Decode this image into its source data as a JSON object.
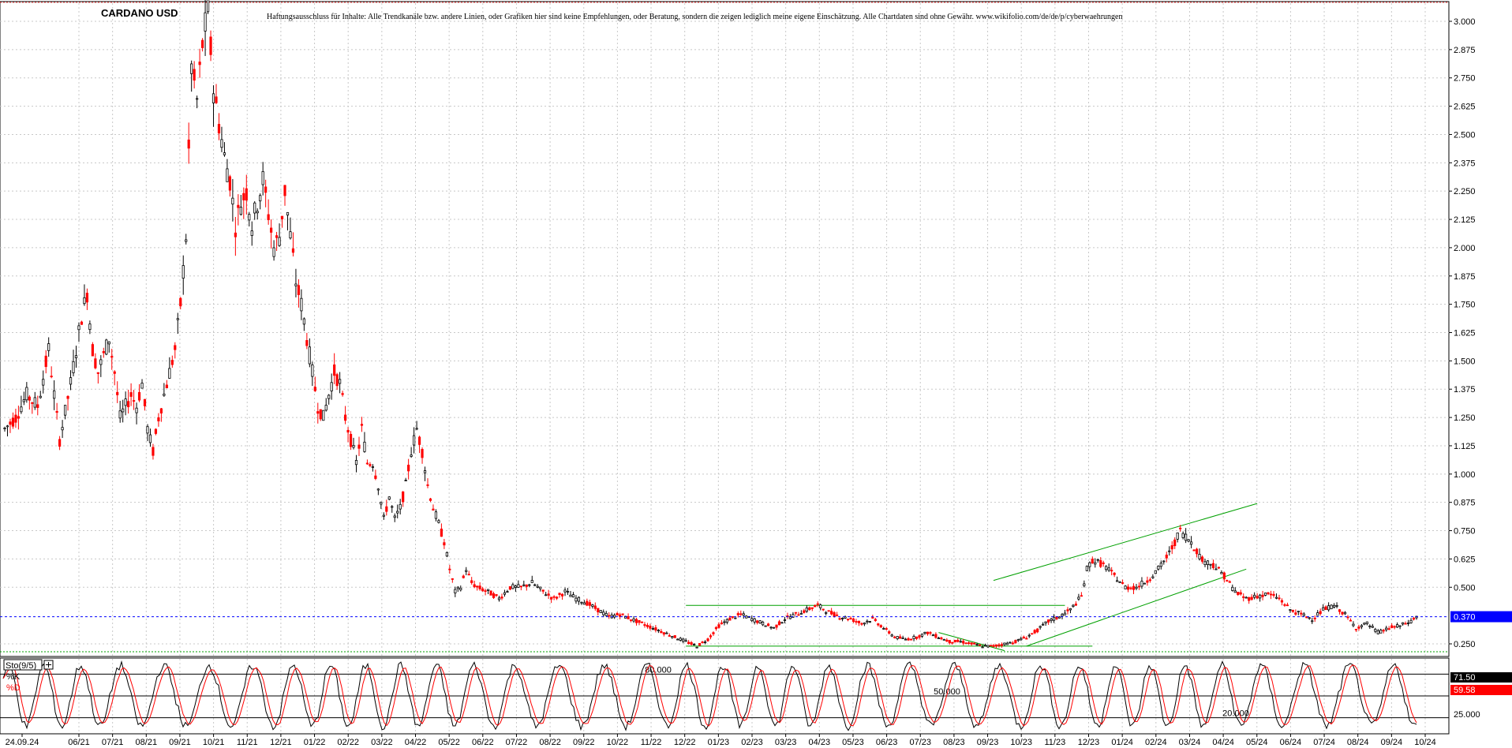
{
  "chart_data": [
    {
      "type": "candlestick",
      "title": "CARDANO USD",
      "disclaimer": "Haftungsausschluss für Inhalte: Alle Trendkanäle bzw. andere Linien, oder Grafiken hier sind keine Empfehlungen, oder Beratung, sondern die zeigen lediglich meine eigene Einschätzung. Alle Chartdaten sind ohne Gewähr. www.wikifolio.com/de/de/p/cyberwaehrungen",
      "ylim": [
        0.2,
        3.15
      ],
      "yticks": [
        "3.000",
        "2.875",
        "2.750",
        "2.625",
        "2.500",
        "2.375",
        "2.250",
        "2.125",
        "2.000",
        "1.875",
        "1.750",
        "1.625",
        "1.500",
        "1.375",
        "1.250",
        "1.125",
        "1.000",
        "0.875",
        "0.750",
        "0.625",
        "0.500",
        "0.370",
        "0.250"
      ],
      "xticks": [
        "24.09.24",
        "06/21",
        "07/21",
        "08/21",
        "09/21",
        "10/21",
        "11/21",
        "12/21",
        "01/22",
        "02/22",
        "03/22",
        "04/22",
        "05/22",
        "06/22",
        "07/22",
        "08/22",
        "09/22",
        "10/22",
        "11/22",
        "12/22",
        "01/23",
        "02/23",
        "03/23",
        "04/23",
        "05/23",
        "06/23",
        "07/23",
        "08/23",
        "09/23",
        "10/23",
        "11/23",
        "12/23",
        "01/24",
        "02/24",
        "03/24",
        "04/24",
        "05/24",
        "06/24",
        "07/24",
        "08/24",
        "09/24",
        "10/24"
      ],
      "up_color": "#000000",
      "down_color": "#ff0000",
      "price_path": [
        [
          0,
          1.2
        ],
        [
          2,
          1.25
        ],
        [
          4,
          1.35
        ],
        [
          6,
          1.3
        ],
        [
          8,
          1.55
        ],
        [
          9,
          1.35
        ],
        [
          10,
          1.15
        ],
        [
          12,
          1.4
        ],
        [
          14,
          1.7
        ],
        [
          15,
          1.8
        ],
        [
          16,
          1.55
        ],
        [
          17,
          1.45
        ],
        [
          19,
          1.6
        ],
        [
          20,
          1.45
        ],
        [
          21,
          1.25
        ],
        [
          23,
          1.35
        ],
        [
          24,
          1.3
        ],
        [
          25,
          1.4
        ],
        [
          26,
          1.2
        ],
        [
          27,
          1.1
        ],
        [
          28,
          1.25
        ],
        [
          29,
          1.35
        ],
        [
          30,
          1.45
        ],
        [
          31,
          1.55
        ],
        [
          32,
          1.75
        ],
        [
          33,
          2.05
        ],
        [
          34,
          2.8
        ],
        [
          35,
          2.65
        ],
        [
          36,
          2.9
        ],
        [
          37,
          3.05
        ],
        [
          38,
          2.7
        ],
        [
          39,
          2.55
        ],
        [
          40,
          2.4
        ],
        [
          41,
          2.3
        ],
        [
          42,
          2.1
        ],
        [
          43,
          2.2
        ],
        [
          44,
          2.25
        ],
        [
          45,
          2.1
        ],
        [
          46,
          2.2
        ],
        [
          47,
          2.3
        ],
        [
          48,
          2.15
        ],
        [
          49,
          2.0
        ],
        [
          50,
          2.05
        ],
        [
          51,
          2.25
        ],
        [
          52,
          2.05
        ],
        [
          53,
          1.85
        ],
        [
          54,
          1.75
        ],
        [
          55,
          1.6
        ],
        [
          56,
          1.45
        ],
        [
          57,
          1.3
        ],
        [
          58,
          1.25
        ],
        [
          59,
          1.35
        ],
        [
          60,
          1.45
        ],
        [
          61,
          1.4
        ],
        [
          62,
          1.25
        ],
        [
          63,
          1.15
        ],
        [
          64,
          1.05
        ],
        [
          65,
          1.2
        ],
        [
          66,
          1.05
        ],
        [
          67,
          1.05
        ],
        [
          68,
          0.95
        ],
        [
          69,
          0.8
        ],
        [
          70,
          0.9
        ],
        [
          71,
          0.8
        ],
        [
          72,
          0.85
        ],
        [
          73,
          0.95
        ],
        [
          74,
          1.1
        ],
        [
          75,
          1.2
        ],
        [
          76,
          1.1
        ],
        [
          77,
          0.95
        ],
        [
          78,
          0.85
        ],
        [
          79,
          0.78
        ],
        [
          80,
          0.7
        ],
        [
          81,
          0.58
        ],
        [
          82,
          0.48
        ],
        [
          83,
          0.5
        ],
        [
          84,
          0.58
        ],
        [
          85,
          0.52
        ],
        [
          86,
          0.5
        ],
        [
          88,
          0.48
        ],
        [
          90,
          0.45
        ],
        [
          92,
          0.5
        ],
        [
          94,
          0.5
        ],
        [
          96,
          0.52
        ],
        [
          98,
          0.48
        ],
        [
          100,
          0.45
        ],
        [
          102,
          0.48
        ],
        [
          104,
          0.45
        ],
        [
          106,
          0.43
        ],
        [
          108,
          0.4
        ],
        [
          110,
          0.37
        ],
        [
          112,
          0.38
        ],
        [
          114,
          0.36
        ],
        [
          116,
          0.34
        ],
        [
          118,
          0.32
        ],
        [
          120,
          0.3
        ],
        [
          122,
          0.28
        ],
        [
          124,
          0.26
        ],
        [
          126,
          0.24
        ],
        [
          128,
          0.27
        ],
        [
          130,
          0.33
        ],
        [
          132,
          0.36
        ],
        [
          134,
          0.38
        ],
        [
          136,
          0.36
        ],
        [
          138,
          0.34
        ],
        [
          140,
          0.32
        ],
        [
          142,
          0.36
        ],
        [
          144,
          0.38
        ],
        [
          146,
          0.4
        ],
        [
          148,
          0.42
        ],
        [
          150,
          0.39
        ],
        [
          152,
          0.37
        ],
        [
          154,
          0.36
        ],
        [
          156,
          0.34
        ],
        [
          158,
          0.36
        ],
        [
          160,
          0.32
        ],
        [
          162,
          0.28
        ],
        [
          164,
          0.27
        ],
        [
          166,
          0.28
        ],
        [
          168,
          0.3
        ],
        [
          170,
          0.28
        ],
        [
          172,
          0.26
        ],
        [
          174,
          0.26
        ],
        [
          176,
          0.25
        ],
        [
          178,
          0.24
        ],
        [
          180,
          0.24
        ],
        [
          182,
          0.25
        ],
        [
          184,
          0.26
        ],
        [
          186,
          0.28
        ],
        [
          188,
          0.31
        ],
        [
          190,
          0.35
        ],
        [
          192,
          0.37
        ],
        [
          194,
          0.4
        ],
        [
          196,
          0.46
        ],
        [
          197,
          0.58
        ],
        [
          198,
          0.62
        ],
        [
          200,
          0.6
        ],
        [
          202,
          0.55
        ],
        [
          204,
          0.5
        ],
        [
          206,
          0.5
        ],
        [
          208,
          0.53
        ],
        [
          210,
          0.58
        ],
        [
          212,
          0.65
        ],
        [
          214,
          0.75
        ],
        [
          216,
          0.7
        ],
        [
          218,
          0.62
        ],
        [
          220,
          0.6
        ],
        [
          222,
          0.55
        ],
        [
          224,
          0.48
        ],
        [
          226,
          0.45
        ],
        [
          228,
          0.46
        ],
        [
          230,
          0.47
        ],
        [
          232,
          0.45
        ],
        [
          234,
          0.4
        ],
        [
          236,
          0.38
        ],
        [
          238,
          0.36
        ],
        [
          240,
          0.4
        ],
        [
          242,
          0.42
        ],
        [
          244,
          0.38
        ],
        [
          246,
          0.32
        ],
        [
          248,
          0.34
        ],
        [
          250,
          0.3
        ],
        [
          252,
          0.32
        ],
        [
          254,
          0.33
        ],
        [
          256,
          0.35
        ],
        [
          257,
          0.37
        ]
      ],
      "last_price": "0.370",
      "trendlines_color": "#00a000"
    },
    {
      "type": "line",
      "indicator_label": "Sto(9/5)",
      "series": [
        {
          "name": "%K",
          "color": "#000000",
          "last_value": "71.50"
        },
        {
          "name": "%D",
          "color": "#ff0000",
          "last_value": "59.58"
        }
      ],
      "ylim": [
        0,
        100
      ],
      "levels": [
        {
          "value": 80,
          "label": "80.000"
        },
        {
          "value": 50,
          "label": "50.000"
        },
        {
          "value": 20,
          "label": "20.000"
        }
      ],
      "yticks": [
        "25.000"
      ]
    }
  ]
}
